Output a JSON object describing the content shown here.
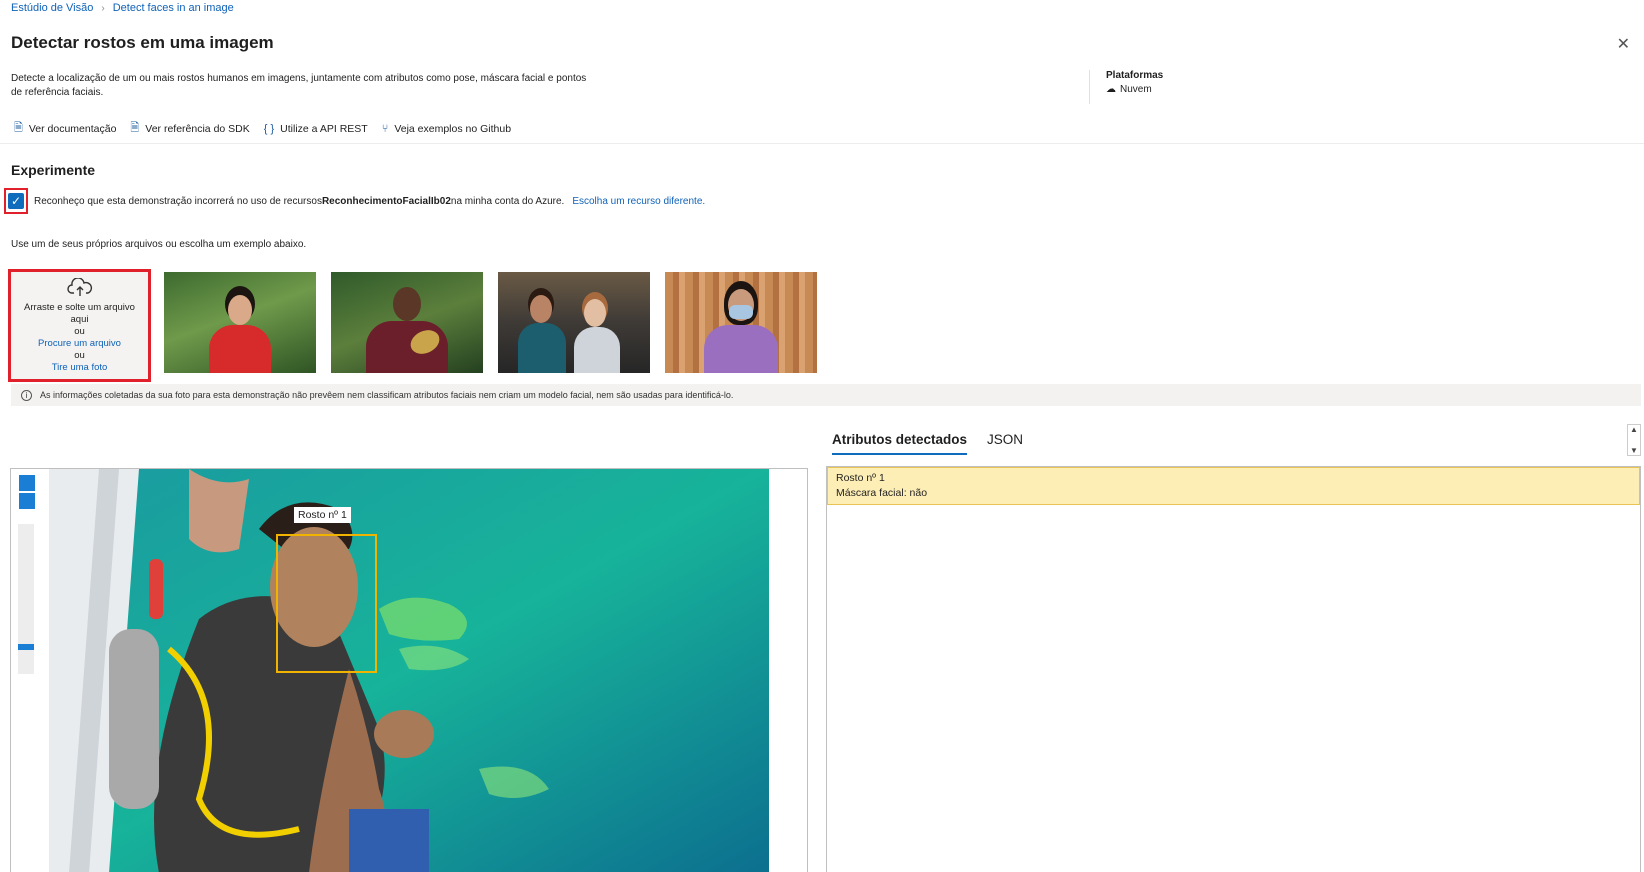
{
  "breadcrumb": {
    "root": "Estúdio de Visão",
    "current": "Detect faces in an image"
  },
  "page": {
    "title": "Detectar rostos em uma imagem",
    "description": "Detecte a localização de um ou mais rostos humanos em imagens, juntamente com atributos como pose, máscara facial e pontos de referência faciais."
  },
  "platforms": {
    "label": "Plataformas",
    "value": "Nuvem"
  },
  "links": [
    {
      "label": "Ver documentação",
      "icon": "document-icon"
    },
    {
      "label": "Ver referência do SDK",
      "icon": "document-icon"
    },
    {
      "label": "Utilize a API REST",
      "icon": "braces-icon"
    },
    {
      "label": "Veja exemplos no Github",
      "icon": "branch-icon"
    }
  ],
  "experiment": {
    "title": "Experimente",
    "ack_prefix": "Reconheço que esta demonstração incorrerá no uso de recursos",
    "ack_resource": "ReconhecimentoFacialIb02",
    "ack_suffix": "na minha conta do Azure.",
    "ack_link": "Escolha um recurso diferente.",
    "ack_checked": true,
    "use_text": "Use um de seus próprios arquivos ou escolha um exemplo abaixo."
  },
  "upload": {
    "line1": "Arraste e solte um arquivo aqui",
    "or1": "ou",
    "browse": "Procure um arquivo",
    "or2": "ou",
    "camera": "Tire uma foto"
  },
  "info": "As informações coletadas da sua foto para esta demonstração não prevêem nem classificam atributos faciais nem criam um modelo facial, nem são usadas para identificá-lo.",
  "tabs": {
    "active": "Atributos detectados",
    "other": "JSON"
  },
  "result": {
    "face_label": "Rosto nº 1",
    "card_title": "Rosto nº 1",
    "card_attr": "Máscara facial: não"
  },
  "colors": {
    "accent": "#0f6cbd",
    "highlight": "#e0202a",
    "face_box": "#f0b400",
    "card_bg": "#fdeeb6"
  }
}
